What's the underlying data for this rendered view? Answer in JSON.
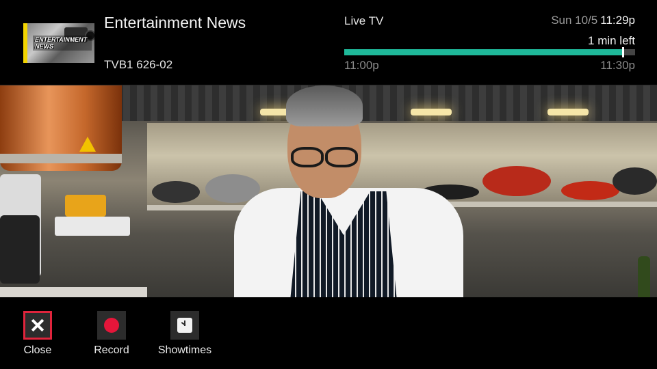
{
  "program": {
    "title": "Entertainment News",
    "channel": "TVB1 626-02",
    "thumbnail_text": "ENTERTAINMENT NEWS"
  },
  "status": {
    "source": "Live TV",
    "date": "Sun 10/5",
    "time": "11:29p",
    "time_left": "1 min left"
  },
  "timeline": {
    "start": "11:00p",
    "end": "11:30p",
    "progress_fraction": 0.958,
    "fill_color": "#1fb99a"
  },
  "controls": [
    {
      "label": "Close",
      "icon": "close-icon",
      "selected": true
    },
    {
      "label": "Record",
      "icon": "record-icon",
      "selected": false
    },
    {
      "label": "Showtimes",
      "icon": "clock-icon",
      "selected": false
    }
  ],
  "colors": {
    "accent_selected": "#e0243c",
    "record_red": "#e5163a"
  }
}
